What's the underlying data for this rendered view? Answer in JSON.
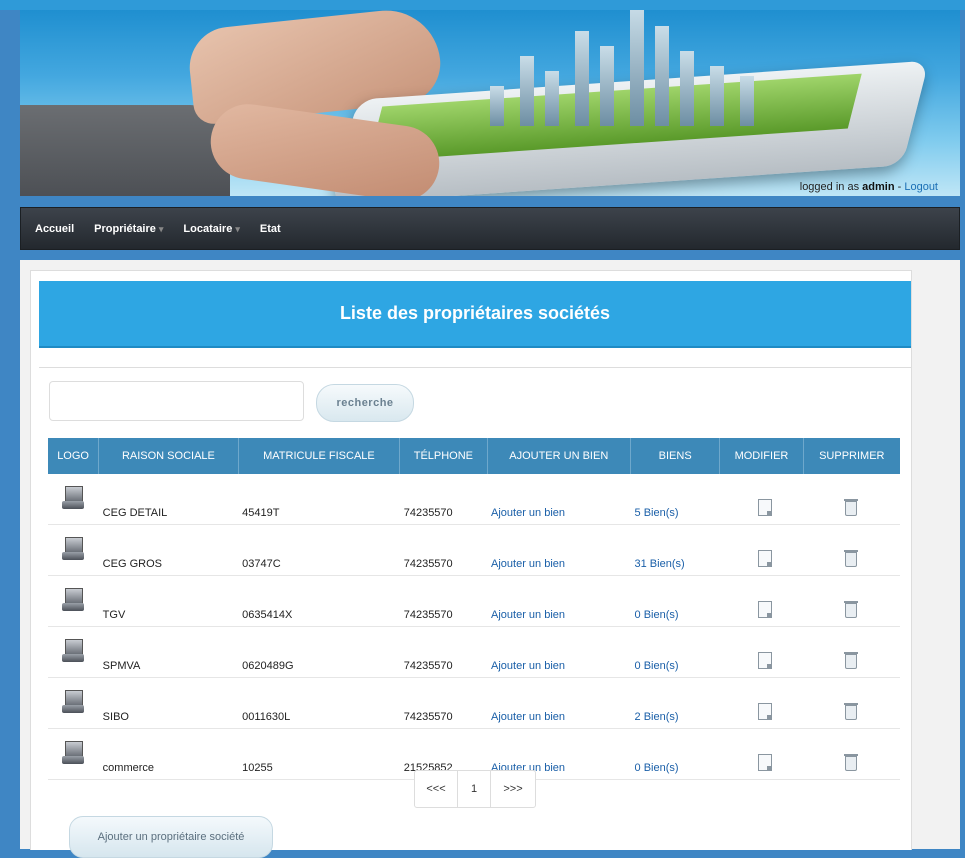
{
  "header": {
    "logged_prefix": "logged in as",
    "user": "admin",
    "separator": "-",
    "logout": "Logout"
  },
  "nav": {
    "items": [
      {
        "label": "Accueil",
        "dropdown": false
      },
      {
        "label": "Propriétaire",
        "dropdown": true
      },
      {
        "label": "Locataire",
        "dropdown": true
      },
      {
        "label": "Etat",
        "dropdown": false
      }
    ]
  },
  "page": {
    "title": "Liste des propriétaires sociétés",
    "search_placeholder": "",
    "search_button": "recherche",
    "add_button": "Ajouter un propriétaire société"
  },
  "table": {
    "columns": [
      "LOGO",
      "RAISON SOCIALE",
      "MATRICULE FISCALE",
      "TÉLPHONE",
      "AJOUTER UN BIEN",
      "BIENS",
      "MODIFIER",
      "SUPPRIMER"
    ],
    "rows": [
      {
        "name": "CEG DETAIL",
        "matricule": "45419T",
        "phone": "74235570",
        "add": "Ajouter un bien",
        "biens": "5 Bien(s)"
      },
      {
        "name": "CEG GROS",
        "matricule": "03747C",
        "phone": "74235570",
        "add": "Ajouter un bien",
        "biens": "31 Bien(s)"
      },
      {
        "name": "TGV",
        "matricule": "0635414X",
        "phone": "74235570",
        "add": "Ajouter un bien",
        "biens": "0 Bien(s)"
      },
      {
        "name": "SPMVA",
        "matricule": "0620489G",
        "phone": "74235570",
        "add": "Ajouter un bien",
        "biens": "0 Bien(s)"
      },
      {
        "name": "SIBO",
        "matricule": "0011630L",
        "phone": "74235570",
        "add": "Ajouter un bien",
        "biens": "2 Bien(s)"
      },
      {
        "name": "commerce",
        "matricule": "10255",
        "phone": "21525852",
        "add": "Ajouter un bien",
        "biens": "0 Bien(s)"
      }
    ]
  },
  "pagination": {
    "prev": "<<<",
    "current": "1",
    "next": ">>>"
  },
  "icons": {
    "logo": "computer-icon",
    "edit": "edit-icon",
    "delete": "trash-icon"
  }
}
